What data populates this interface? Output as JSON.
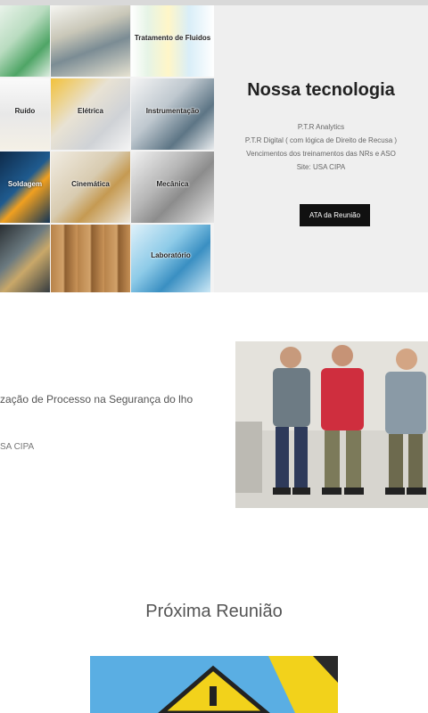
{
  "collage": {
    "tiles": [
      {
        "caption": ""
      },
      {
        "caption": ""
      },
      {
        "caption": "Tratamento de Fluidos"
      },
      {
        "caption": "Ruído"
      },
      {
        "caption": "Elétrica"
      },
      {
        "caption": "Instrumentação"
      },
      {
        "caption": "Soldagem"
      },
      {
        "caption": "Cinemática"
      },
      {
        "caption": "Mecânica"
      },
      {
        "caption": ""
      },
      {
        "caption": ""
      },
      {
        "caption": "Laboratório"
      }
    ]
  },
  "tech": {
    "title": "Nossa tecnologia",
    "line1": "P.T.R Analytics",
    "line2": "P.T.R Digital ( com lógica de Direito de Recusa )",
    "line3": "Vencimentos dos treinamentos das NRs e ASO",
    "line4": "Site: USA CIPA",
    "button": "ATA da Reunião"
  },
  "mid": {
    "text1": "zação de Processo na Segurança do lho",
    "text2": "SA CIPA"
  },
  "next": {
    "title": "Próxima Reunião"
  },
  "colors": {
    "panel": "#efefef",
    "button": "#111111",
    "banner_blue": "#5aaee3",
    "banner_yellow": "#f2d21b"
  }
}
